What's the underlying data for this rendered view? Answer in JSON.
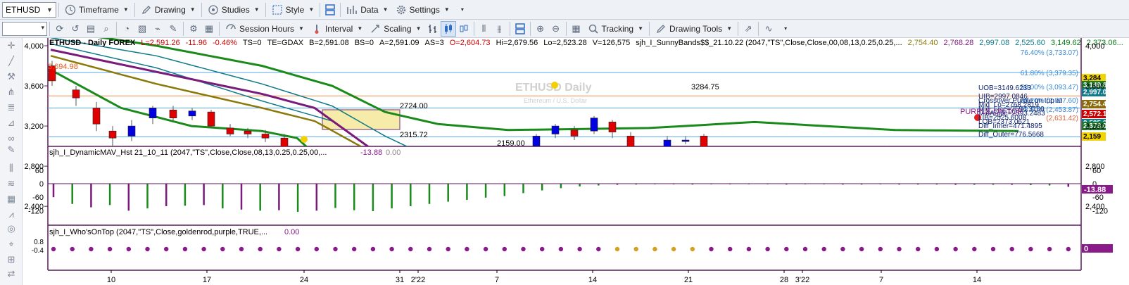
{
  "toolbar1": {
    "symbol": "ETHUSD",
    "items": [
      {
        "label": "Timeframe",
        "icon": "clock-icon"
      },
      {
        "label": "Drawing",
        "icon": "pencil-icon"
      },
      {
        "label": "Studies",
        "icon": "circle-cycle-icon"
      },
      {
        "label": "Style",
        "icon": "style-icon"
      },
      {
        "label": "Data",
        "icon": "data-grid-icon"
      },
      {
        "label": "Settings",
        "icon": "gear-icon"
      }
    ]
  },
  "toolbar2": {
    "session_hours": "Session Hours",
    "interval": "Interval",
    "scaling": "Scaling",
    "tracking": "Tracking",
    "drawing_tools": "Drawing Tools"
  },
  "header": {
    "symbol": "ETHUSD - Daily  FOREX",
    "last": "L=2,591.26",
    "change": "-11.96",
    "pct": "-0.46%",
    "ts": "TS=0",
    "te": "TE=GDAX",
    "bid": "B=2,591.08",
    "bs": "BS=0",
    "ask": "A=2,591.09",
    "as": "AS=3",
    "open": "O=2,604.73",
    "high": "Hi=2,679.56",
    "low": "Lo=2,523.28",
    "vol": "V=126,575",
    "study": "sjh_I_SunnyBands$$_21.10.22 (2047,\"TS\",Close,Close,00,08,13,0.25,0.25,...",
    "study_values": [
      {
        "v": "2,754.40",
        "color": "#8a7a0a"
      },
      {
        "v": "2,768.28",
        "color": "#7a1a7a"
      },
      {
        "v": "2,997.08",
        "color": "#0e7a8a"
      },
      {
        "v": "2,525.60",
        "color": "#0e7a8a"
      },
      {
        "v": "3,149.62",
        "color": "#0a7a1a"
      },
      {
        "v": "2,373.06...",
        "color": "#0a7a1a"
      }
    ]
  },
  "panel2": {
    "title": "sjh_I_DynamicMAV_Hst 21_10_11 (2047,\"TS\",Close,Close,08,13,0.25,0.25,00,...",
    "v1": "-13.88",
    "v2": "0.00"
  },
  "panel3": {
    "title": "sjh_I_Who'sOnTop (2047,\"TS\",Close,goldenrod,purple,TRUE,...",
    "v1": "0.00"
  },
  "price_axis": [
    "4,000",
    "3,600",
    "3,200",
    "2,800",
    "2,400"
  ],
  "price_axis_right": [
    "4,000",
    "3,600",
    "3,200",
    "2,800",
    "2,400"
  ],
  "osc_axis": [
    "60",
    "0",
    "-60",
    "-120"
  ],
  "top_axis": [
    "0.8",
    "-0.4"
  ],
  "date_axis": [
    "10",
    "17",
    "24",
    "31",
    "2'22",
    "7",
    "14",
    "21",
    "28",
    "3'22",
    "7",
    "14"
  ],
  "fib_labels": [
    {
      "text": "76.40% (3,733.07)",
      "color": "#3a8ad8"
    },
    {
      "text": "61.80% (3,379.35)",
      "color": "#3a8ad8"
    },
    {
      "text": "50.00% (3,093.47)",
      "color": "#3a8ad8"
    },
    {
      "text": "38.20% (2,807.60)",
      "color": "#3a8ad8"
    },
    {
      "text": "23.60% (2,453.87)",
      "color": "#3a8ad8"
    },
    {
      "text": "(2,631.42)",
      "color": "#e0603a"
    }
  ],
  "chart_annotations": {
    "price_left": "3,694.98",
    "low_1": "2315.72",
    "point_2724": "2724.00",
    "low_2": "2159.00",
    "high_1": "3284.75",
    "watermark": "ETHUSD Daily",
    "watermark_sub": "Ethereum / U.S. Dollar"
  },
  "info_box": [
    "Crossover Purple on top at",
    "UOB=3149.6233",
    "UIB=2997.0846",
    "Mid_Lo=2768.2819",
    "Mid_Line=2594.3100",
    "MidAngle=2593.2483",
    "LIB=2525.6008",
    "LOB=2373.0621",
    "Diff_Inner=471.4895",
    "Diff_Outer=776.5668"
  ],
  "purple_label": "PURPLE ON TOP",
  "right_tags": [
    {
      "v": "3,284",
      "bg": "#f2d400",
      "fg": "#000"
    },
    {
      "v": "3,149.6",
      "bg": "#1a7a2a",
      "fg": "#fff"
    },
    {
      "v": "2,997.0",
      "bg": "#0e7a8a",
      "fg": "#fff"
    },
    {
      "v": "2,754.4",
      "bg": "#8a6a0a",
      "fg": "#fff"
    },
    {
      "v": "2,572.1",
      "bg": "#d00000",
      "fg": "#fff"
    },
    {
      "v": "2,525.6",
      "bg": "#0e7a8a",
      "fg": "#fff"
    },
    {
      "v": "2,373.0",
      "bg": "#1a7a2a",
      "fg": "#fff"
    },
    {
      "v": "2,159",
      "bg": "#f2d400",
      "fg": "#000"
    }
  ],
  "osc_tag": "-13.88",
  "top_tag": "0"
}
